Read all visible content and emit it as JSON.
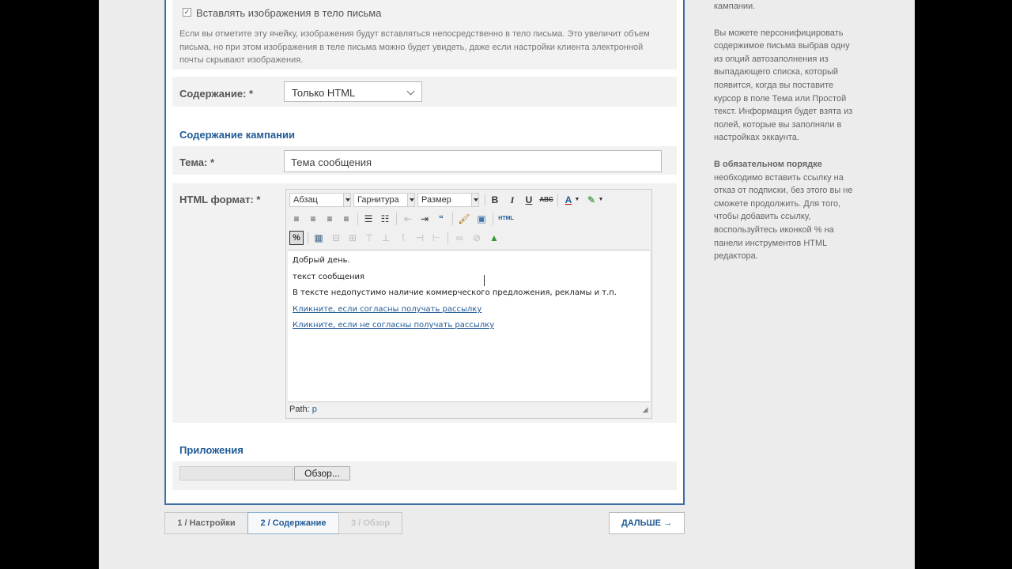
{
  "images_checkbox": {
    "label": "Вставлять изображения в тело письма",
    "checked": true
  },
  "images_note": "Если вы отметите эту ячейку, изображения будут вставляться непосредственно в тело письма. Это увеличит объем письма, но при этом изображения в теле письма можно будет увидеть, даже если настройки клиента электронной почты скрывают изображения.",
  "content_field": {
    "label": "Содержание: *",
    "value": "Только HTML"
  },
  "section_title": "Содержание кампании",
  "subject_field": {
    "label": "Тема: *",
    "value": "Тема сообщения"
  },
  "html_field": {
    "label": "HTML формат: *"
  },
  "editor": {
    "format_select": "Абзац",
    "font_select": "Гарнитура",
    "size_select": "Размер",
    "lines": [
      "Добрый день.",
      "текст сообщения",
      "В тексте недопустимо наличие коммерческого предложения, рекламы и т.п."
    ],
    "link_subscribe": "Кликните, если согласны получать рассылку",
    "link_unsubscribe": "Кликните, если не согласны получать рассылку",
    "path_label": "Path:",
    "path_value": "p"
  },
  "attachments": {
    "title": "Приложения",
    "browse_label": "Обзор..."
  },
  "steps": [
    {
      "label": "1 / Настройки",
      "state": "done"
    },
    {
      "label": "2 / Содержание",
      "state": "active"
    },
    {
      "label": "3 / Обзор",
      "state": "disabled"
    }
  ],
  "next_button": "ДАЛЬШЕ →",
  "help": {
    "top_fragment": "кампании.",
    "personalize": "Вы можете персонифицировать содержимое письма выбрав одну из опций автозаполнения из выпадающего списка, который появится, когда вы поставите курсор в поле Тема или Простой текст. Информация будет взята из полей, которые вы заполняли в настройках эккаунта.",
    "required_bold": "В обязательном порядке",
    "required_rest": " необходимо вставить ссылку на отказ от подписки, без этого вы не сможете продолжить. Для того, чтобы добавить ссылку, воспользуйтесь иконкой % на панели инструментов HTML редактора."
  },
  "colors": {
    "accent": "#1f5a96",
    "panel_border": "#3a6ea5",
    "background": "#ececec"
  }
}
